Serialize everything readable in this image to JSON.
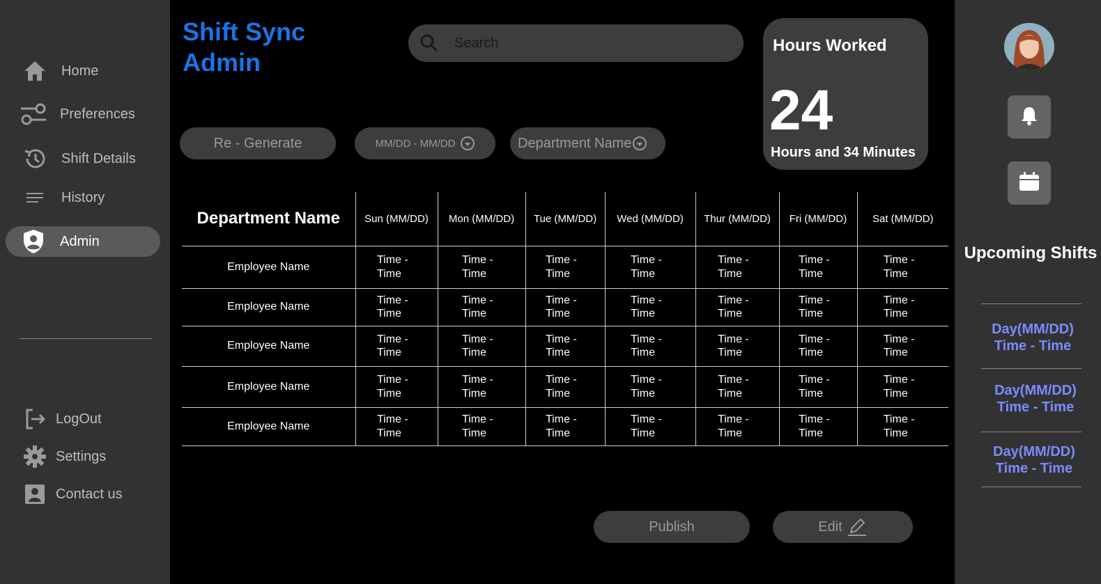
{
  "app": {
    "title_line1": "Shift Sync",
    "title_line2": "Admin"
  },
  "sidebar": {
    "items": [
      {
        "label": "Home",
        "icon": "home-icon"
      },
      {
        "label": "Preferences",
        "icon": "preferences-icon"
      },
      {
        "label": "Shift Details",
        "icon": "history-clock-icon"
      },
      {
        "label": "History",
        "icon": "list-icon"
      },
      {
        "label": "Admin",
        "icon": "admin-shield-icon",
        "active": true
      }
    ],
    "bottom_items": [
      {
        "label": "LogOut",
        "icon": "logout-icon"
      },
      {
        "label": "Settings",
        "icon": "gear-icon"
      },
      {
        "label": "Contact us",
        "icon": "contact-icon"
      }
    ]
  },
  "search": {
    "placeholder": "Search"
  },
  "hours_card": {
    "label": "Hours Worked",
    "hours": "24",
    "subtitle": "Hours and 34 Minutes"
  },
  "controls": {
    "regenerate_label": "Re - Generate",
    "date_range": "MM/DD - MM/DD",
    "department": "Department Name",
    "publish_label": "Publish",
    "edit_label": "Edit"
  },
  "table": {
    "header_dept": "Department Name",
    "days": [
      "Sun (MM/DD)",
      "Mon (MM/DD)",
      "Tue (MM/DD)",
      "Wed (MM/DD)",
      "Thur (MM/DD)",
      "Fri (MM/DD)",
      "Sat (MM/DD)"
    ],
    "rows": [
      {
        "employee": "Employee Name",
        "shifts": [
          "Time - Time",
          "Time - Time",
          "Time - Time",
          "Time - Time",
          "Time - Time",
          "Time - Time",
          "Time - Time"
        ]
      },
      {
        "employee": "Employee Name",
        "shifts": [
          "Time - Time",
          "Time - Time",
          "Time - Time",
          "Time - Time",
          "Time - Time",
          "Time - Time",
          "Time - Time"
        ]
      },
      {
        "employee": "Employee Name",
        "shifts": [
          "Time - Time",
          "Time - Time",
          "Time - Time",
          "Time - Time",
          "Time - Time",
          "Time - Time",
          "Time - Time"
        ]
      },
      {
        "employee": "Employee Name",
        "shifts": [
          "Time - Time",
          "Time - Time",
          "Time - Time",
          "Time - Time",
          "Time - Time",
          "Time - Time",
          "Time - Time"
        ]
      },
      {
        "employee": "Employee Name",
        "shifts": [
          "Time - Time",
          "Time - Time",
          "Time - Time",
          "Time - Time",
          "Time - Time",
          "Time - Time",
          "Time - Time"
        ]
      }
    ]
  },
  "right_panel": {
    "upcoming_title": "Upcoming Shifts",
    "shifts": [
      {
        "day": "Day(MM/DD)",
        "time": "Time - Time"
      },
      {
        "day": "Day(MM/DD)",
        "time": "Time - Time"
      },
      {
        "day": "Day(MM/DD)",
        "time": "Time - Time"
      }
    ]
  },
  "colors": {
    "accent_blue": "#1a73e8",
    "upcoming_text": "#7b8cff",
    "panel_bg": "#323232",
    "pill_bg": "#3d3d3d"
  }
}
